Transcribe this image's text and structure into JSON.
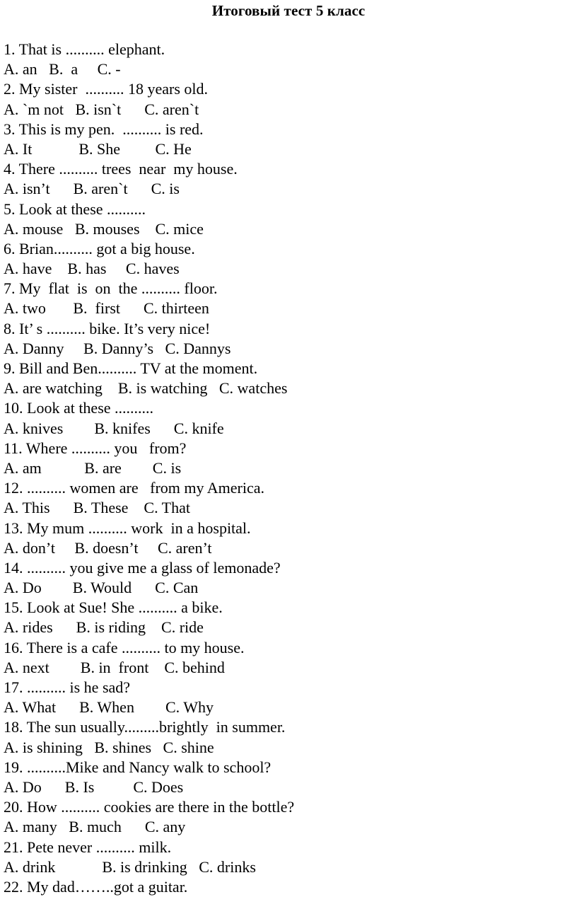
{
  "document": {
    "title": "Итоговый тест 5 класс",
    "language": "ru-en",
    "background_color": "#ffffff",
    "text_color": "#000000"
  },
  "questions": [
    {
      "number": "1",
      "prompt": "1. That is .......... elephant.",
      "options": "A. an   B.  a     C. -"
    },
    {
      "number": "2",
      "prompt": "2. My sister  .......... 18 years old.",
      "options": "A. `m not   B. isn`t      C. aren`t"
    },
    {
      "number": "3",
      "prompt": "3. This is my pen.  .......... is red.",
      "options": "A. It            B. She         C. He"
    },
    {
      "number": "4",
      "prompt": "4. There .......... trees  near  my house.",
      "options": "A. isn’t      B. aren`t      C. is"
    },
    {
      "number": "5",
      "prompt": "5. Look at these ..........",
      "options": "A. mouse   B. mouses    C. mice"
    },
    {
      "number": "6",
      "prompt": "6. Brian.......... got a big house.",
      "options": "A. have    B. has     C. haves"
    },
    {
      "number": "7",
      "prompt": "7. My  flat  is  on  the .......... floor.",
      "options": "A. two       B.  first      C. thirteen"
    },
    {
      "number": "8",
      "prompt": "8. It’ s .......... bike. It’s very nice!",
      "options": "A. Danny     B. Danny’s   C. Dannys"
    },
    {
      "number": "9",
      "prompt": "9. Bill and Ben.......... TV at the moment.",
      "options": "A. are watching    B. is watching   C. watches"
    },
    {
      "number": "10",
      "prompt": "10. Look at these ..........",
      "options": "A. knives        B. knifes      C. knife"
    },
    {
      "number": "11",
      "prompt": "11. Where .......... you   from?",
      "options": "A. am           B. are        C. is"
    },
    {
      "number": "12",
      "prompt": "12. .......... women are   from my America.",
      "options": "A. This      B. These    C. That"
    },
    {
      "number": "13",
      "prompt": "13. My mum .......... work  in a hospital.",
      "options": "A. don’t     B. doesn’t     C. aren’t"
    },
    {
      "number": "14",
      "prompt": "14. .......... you give me a glass of lemonade?",
      "options": "A. Do        B. Would      C. Can"
    },
    {
      "number": "15",
      "prompt": "15. Look at Sue! She .......... a bike.",
      "options": "A. rides      B. is riding    C. ride"
    },
    {
      "number": "16",
      "prompt": "16. There is a cafe .......... to my house.",
      "options": "A. next        B. in  front    C. behind"
    },
    {
      "number": "17",
      "prompt": "17. .......... is he sad?",
      "options": "A. What      B. When        C. Why"
    },
    {
      "number": "18",
      "prompt": "18. The sun usually.........brightly  in summer.",
      "options": "A. is shining   B. shines   C. shine"
    },
    {
      "number": "19",
      "prompt": "19. ..........Mike and Nancy walk to school?",
      "options": "A. Do      B. Is          C. Does"
    },
    {
      "number": "20",
      "prompt": "20. How .......... cookies are there in the bottle?",
      "options": "A. many   B. much      C. any"
    },
    {
      "number": "21",
      "prompt": "21. Pete never .......... milk.",
      "options": "A. drink            B. is drinking   C. drinks"
    },
    {
      "number": "22",
      "prompt": "22. My dad……..got a guitar.",
      "options": ""
    }
  ]
}
